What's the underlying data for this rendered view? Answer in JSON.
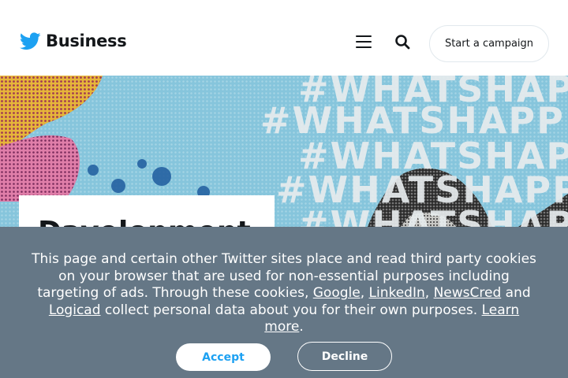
{
  "header": {
    "brand": "Business",
    "menu_icon": "hamburger-menu-icon",
    "search_icon": "search-icon",
    "cta_label": "Start a campaign"
  },
  "hero": {
    "hashtags": [
      "#WHATSHAPPENING",
      "#WHATSHAPPENING",
      "#WHATSHAPPENING",
      "#WHATSHAPPENING",
      "#WHATSHAPPENING"
    ],
    "card_title": "Davelopment"
  },
  "cookie_banner": {
    "text_1": "This page and certain other Twitter sites place and read third party cookies on your browser that are used for non-essential purposes including targeting of ads. Through these cookies, ",
    "link_google": "Google",
    "sep_1": ", ",
    "link_linkedin": "LinkedIn",
    "sep_2": ", ",
    "link_newscred": "NewsCred",
    "text_2": " and ",
    "link_logicad": "Logicad",
    "text_3": " collect personal data about you for their own purposes. ",
    "link_learn_more": "Learn more",
    "text_4": ".",
    "accept_label": "Accept",
    "decline_label": "Decline"
  },
  "colors": {
    "twitter_blue": "#1da1f2",
    "banner_bg": "#657786",
    "text_dark": "#14171a",
    "hero_sky": "#86c5dc"
  }
}
